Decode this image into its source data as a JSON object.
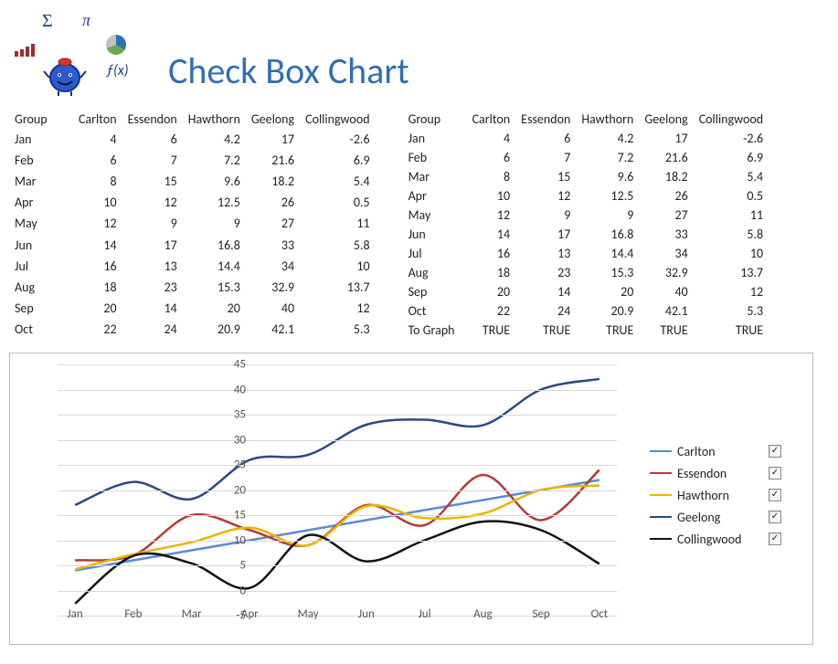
{
  "title": "Check Box Chart",
  "columns": [
    "Group",
    "Carlton",
    "Essendon",
    "Hawthorn",
    "Geelong",
    "Collingwood"
  ],
  "months": [
    "Jan",
    "Feb",
    "Mar",
    "Apr",
    "May",
    "Jun",
    "Jul",
    "Aug",
    "Sep",
    "Oct"
  ],
  "table1": {
    "rows": [
      [
        "Jan",
        4,
        6,
        4.2,
        17,
        -2.6
      ],
      [
        "Feb",
        6,
        7,
        7.2,
        21.6,
        6.9
      ],
      [
        "Mar",
        8,
        15,
        9.6,
        18.2,
        5.4
      ],
      [
        "Apr",
        10,
        12,
        12.5,
        26,
        0.5
      ],
      [
        "May",
        12,
        9,
        9,
        27,
        11
      ],
      [
        "Jun",
        14,
        17,
        16.8,
        33,
        5.8
      ],
      [
        "Jul",
        16,
        13,
        14.4,
        34,
        10
      ],
      [
        "Aug",
        18,
        23,
        15.3,
        32.9,
        13.7
      ],
      [
        "Sep",
        20,
        14,
        20,
        40,
        12
      ],
      [
        "Oct",
        22,
        24,
        20.9,
        42.1,
        5.3
      ]
    ]
  },
  "table2": {
    "rows": [
      [
        "Jan",
        4,
        6,
        4.2,
        17,
        -2.6
      ],
      [
        "Feb",
        6,
        7,
        7.2,
        21.6,
        6.9
      ],
      [
        "Mar",
        8,
        15,
        9.6,
        18.2,
        5.4
      ],
      [
        "Apr",
        10,
        12,
        12.5,
        26,
        0.5
      ],
      [
        "May",
        12,
        9,
        9,
        27,
        11
      ],
      [
        "Jun",
        14,
        17,
        16.8,
        33,
        5.8
      ],
      [
        "Jul",
        16,
        13,
        14.4,
        34,
        10
      ],
      [
        "Aug",
        18,
        23,
        15.3,
        32.9,
        13.7
      ],
      [
        "Sep",
        20,
        14,
        20,
        40,
        12
      ],
      [
        "Oct",
        22,
        24,
        20.9,
        42.1,
        5.3
      ]
    ],
    "to_graph_label": "To Graph",
    "to_graph": [
      "TRUE",
      "TRUE",
      "TRUE",
      "TRUE",
      "TRUE"
    ]
  },
  "chart_data": {
    "type": "line",
    "categories": [
      "Jan",
      "Feb",
      "Mar",
      "Apr",
      "May",
      "Jun",
      "Jul",
      "Aug",
      "Sep",
      "Oct"
    ],
    "series": [
      {
        "name": "Carlton",
        "color": "#5A8BD6",
        "values": [
          4,
          6,
          8,
          10,
          12,
          14,
          16,
          18,
          20,
          22
        ]
      },
      {
        "name": "Essendon",
        "color": "#B53A36",
        "values": [
          6,
          7,
          15,
          12,
          9,
          17,
          13,
          23,
          14,
          24
        ]
      },
      {
        "name": "Hawthorn",
        "color": "#E8B500",
        "values": [
          4.2,
          7.2,
          9.6,
          12.5,
          9,
          16.8,
          14.4,
          15.3,
          20,
          20.9
        ]
      },
      {
        "name": "Geelong",
        "color": "#2A4A7F",
        "values": [
          17,
          21.6,
          18.2,
          26,
          27,
          33,
          34,
          32.9,
          40,
          42.1
        ]
      },
      {
        "name": "Collingwood",
        "color": "#111111",
        "values": [
          -2.6,
          6.9,
          5.4,
          0.5,
          11,
          5.8,
          10,
          13.7,
          12,
          5.3
        ]
      }
    ],
    "ylim": [
      -5,
      45
    ],
    "y_ticks": [
      -5,
      0,
      5,
      10,
      15,
      20,
      25,
      30,
      35,
      40,
      45
    ],
    "xlabel": "",
    "ylabel": "",
    "title": ""
  },
  "legend": {
    "checkbox_glyph": "✓"
  }
}
